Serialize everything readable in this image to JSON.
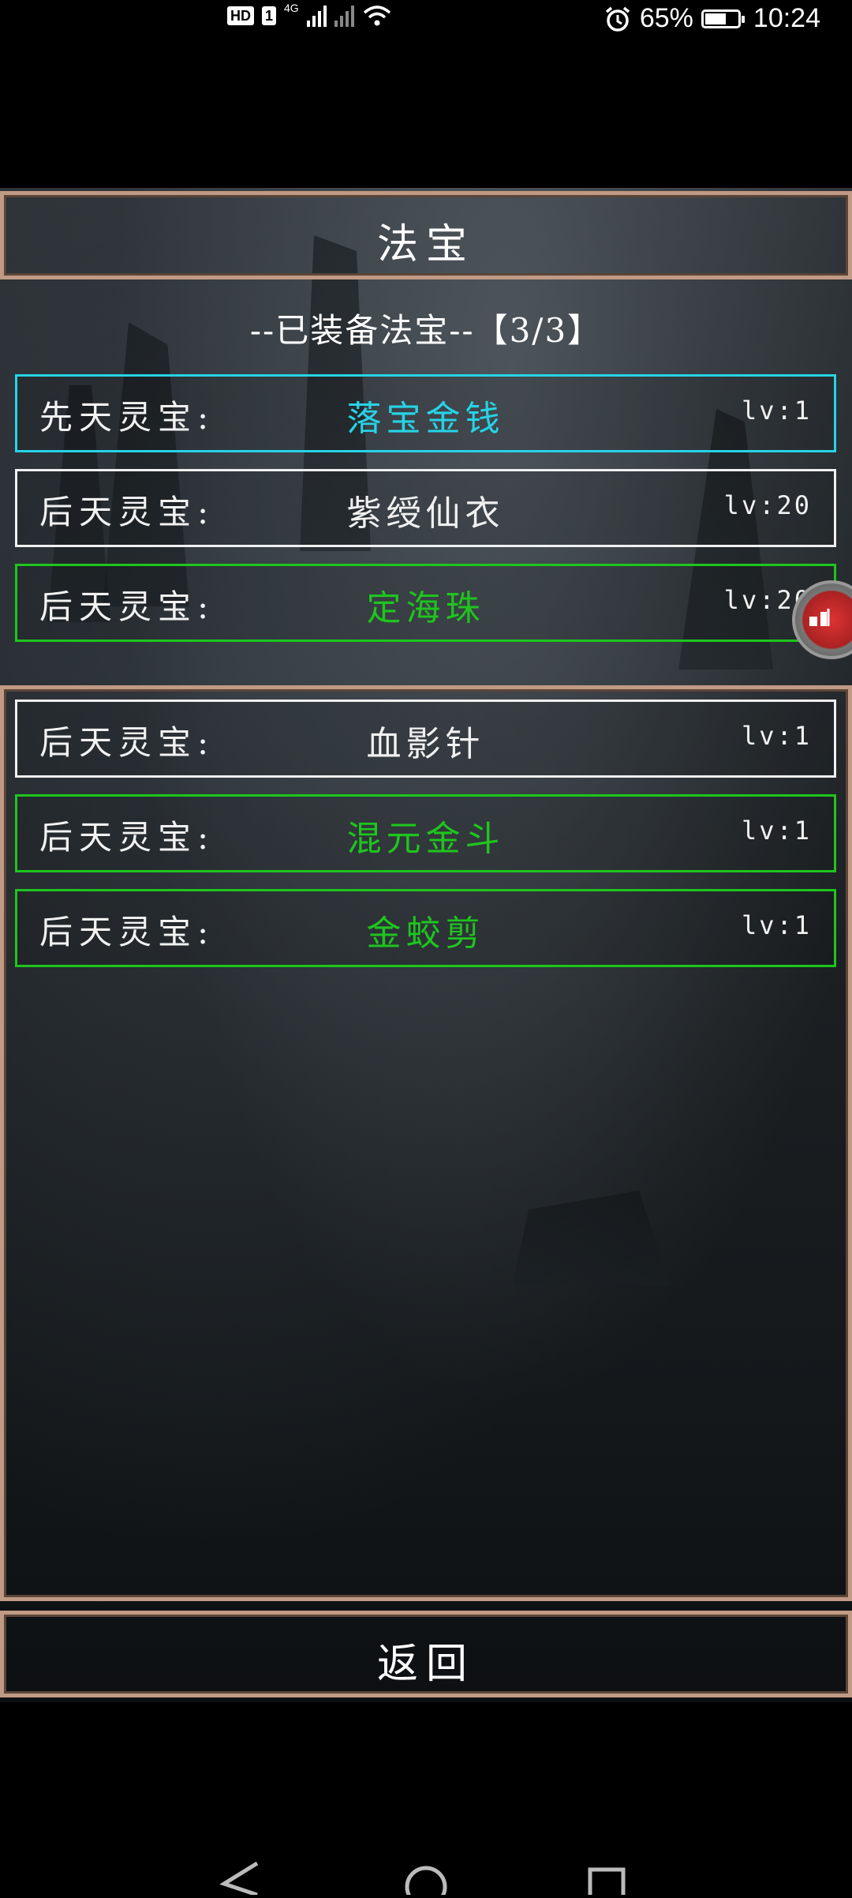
{
  "status_bar": {
    "hd_badge": "HD",
    "sim_badge": "1",
    "network": "4G",
    "battery_percent": "65%",
    "battery_level": 0.65,
    "time": "10:24"
  },
  "dialog": {
    "title": "法宝",
    "equipped_header": "--已装备法宝--【3/3】",
    "equipped": [
      {
        "type": "先天灵宝:",
        "name": "落宝金钱",
        "level": "lv:1",
        "color": "#27d3e6"
      },
      {
        "type": "后天灵宝:",
        "name": "紫绶仙衣",
        "level": "lv:20",
        "color": "#f0f0f0"
      },
      {
        "type": "后天灵宝:",
        "name": "定海珠",
        "level": "lv:20",
        "color": "#1ec51e"
      }
    ],
    "inventory": [
      {
        "type": "后天灵宝:",
        "name": "血影针",
        "level": "lv:1",
        "color": "#f0f0f0"
      },
      {
        "type": "后天灵宝:",
        "name": "混元金斗",
        "level": "lv:1",
        "color": "#1ec51e"
      },
      {
        "type": "后天灵宝:",
        "name": "金蛟剪",
        "level": "lv:1",
        "color": "#1ec51e"
      }
    ],
    "back_label": "返回"
  },
  "icons": {
    "float_button": "floating-assist-icon",
    "nav_back": "nav-back-icon",
    "nav_home": "nav-home-icon",
    "nav_recents": "nav-recents-icon"
  }
}
